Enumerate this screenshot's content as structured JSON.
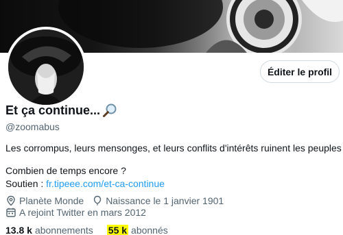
{
  "profile": {
    "name": "Et ça continue...",
    "name_emoji_icon": "magnifier-icon",
    "handle": "@zoomabus",
    "edit_button_label": "Éditer le profil",
    "bio_line1": "Les corrompus, leurs mensonges, et leurs conflits d'intérêts ruinent les peuples !",
    "bio_line2": "Combien de temps encore ?",
    "bio_support_prefix": "Soutien :",
    "bio_support_link": "fr.tipeee.com/et-ca-continue",
    "location": "Planète Monde",
    "birth": "Naissance le 1 janvier 1901",
    "joined": "A rejoint Twitter en mars 2012",
    "following_count": "13.8 k",
    "following_label": "abonnements",
    "followers_count": "55 k",
    "followers_label": "abonnés"
  },
  "colors": {
    "text_primary": "#0f1419",
    "text_secondary": "#536471",
    "link": "#1d9bf0",
    "highlight": "#ffff00"
  }
}
